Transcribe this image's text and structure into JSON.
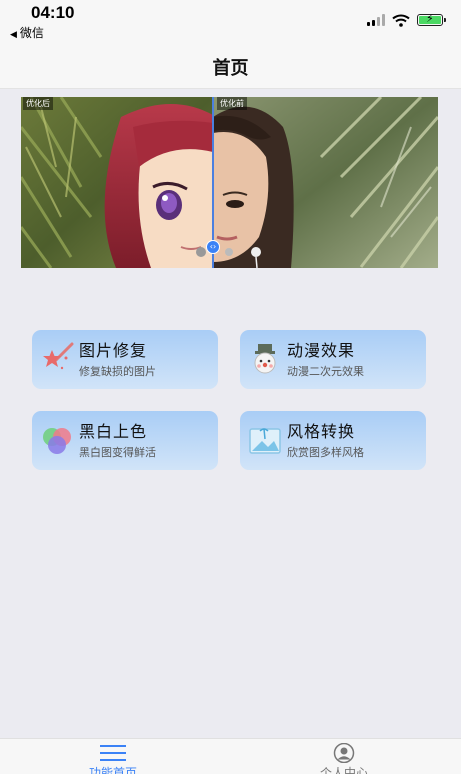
{
  "status": {
    "time": "04:10",
    "back_app": "微信"
  },
  "nav": {
    "title": "首页"
  },
  "compare": {
    "after_label": "优化后",
    "before_label": "优化前"
  },
  "features": [
    {
      "title": "图片修复",
      "subtitle": "修复缺损的图片",
      "icon": "magic-wand-icon"
    },
    {
      "title": "动漫效果",
      "subtitle": "动漫二次元效果",
      "icon": "snowman-icon"
    },
    {
      "title": "黑白上色",
      "subtitle": "黑白图变得鲜活",
      "icon": "color-circles-icon"
    },
    {
      "title": "风格转换",
      "subtitle": "欣赏图多样风格",
      "icon": "landscape-icon"
    }
  ],
  "tabs": [
    {
      "label": "功能首页",
      "active": true,
      "icon": "menu-icon"
    },
    {
      "label": "个人中心",
      "active": false,
      "icon": "user-icon"
    }
  ],
  "colors": {
    "accent": "#3b82f6",
    "card_top": "#a9cdf6",
    "card_bottom": "#d1e4f8",
    "page_bg": "#ebebf1"
  }
}
